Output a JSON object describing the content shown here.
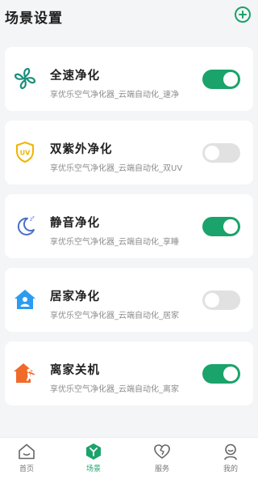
{
  "header": {
    "title": "场景设置",
    "add_icon": "plus-circle-icon"
  },
  "scenes": [
    {
      "name": "全速净化",
      "desc": "享优乐空气净化器_云端自动化_速净",
      "enabled": true,
      "icon": "fan-icon"
    },
    {
      "name": "双紫外净化",
      "desc": "享优乐空气净化器_云端自动化_双UV",
      "enabled": false,
      "icon": "uv-shield-icon"
    },
    {
      "name": "静音净化",
      "desc": "享优乐空气净化器_云端自动化_享睡",
      "enabled": true,
      "icon": "moon-icon"
    },
    {
      "name": "居家净化",
      "desc": "享优乐空气净化器_云端自动化_居家",
      "enabled": false,
      "icon": "home-person-icon"
    },
    {
      "name": "离家关机",
      "desc": "享优乐空气净化器_云端自动化_离家",
      "enabled": true,
      "icon": "leave-home-icon"
    }
  ],
  "bottom_nav": [
    {
      "label": "首页",
      "icon": "home-icon",
      "active": false
    },
    {
      "label": "场景",
      "icon": "scene-icon",
      "active": true
    },
    {
      "label": "服务",
      "icon": "heart-icon",
      "active": false
    },
    {
      "label": "我的",
      "icon": "user-icon",
      "active": false
    }
  ],
  "colors": {
    "accent": "#1aa36a",
    "toggle_off": "#e1e1e1",
    "uv_yellow": "#f0b400",
    "moon_blue": "#4a6fc9",
    "home_blue": "#2b9cf0",
    "leave_orange": "#f06a2a"
  }
}
